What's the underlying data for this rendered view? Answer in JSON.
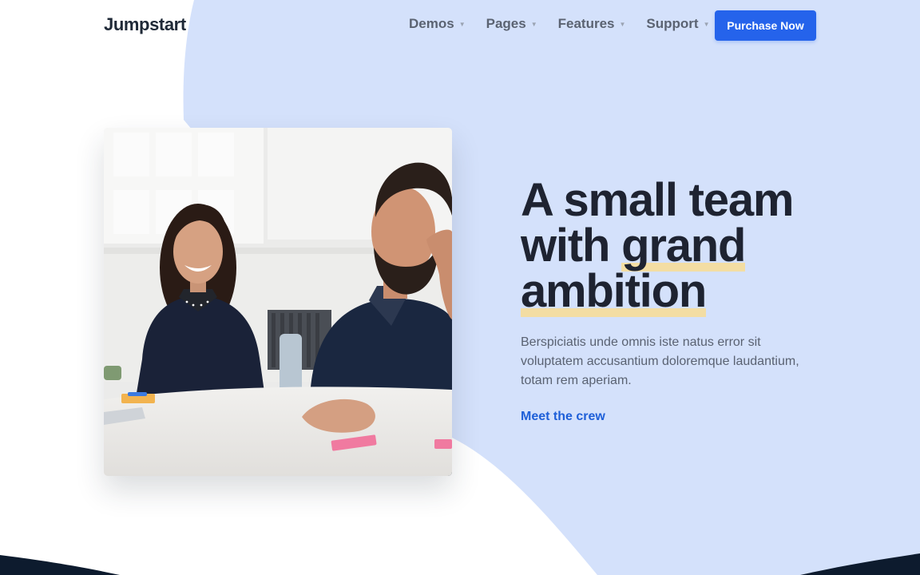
{
  "brand": {
    "name": "Jumpstart"
  },
  "nav": {
    "items": [
      {
        "label": "Demos"
      },
      {
        "label": "Pages"
      },
      {
        "label": "Features"
      },
      {
        "label": "Support"
      }
    ],
    "cta_label": "Purchase Now"
  },
  "hero": {
    "title_line1": "A small team",
    "title_line2_pre": "with ",
    "title_line2_highlight": "grand",
    "title_line3_highlight": "ambition",
    "lead": "Berspiciatis unde omnis iste natus error sit voluptatem accusantium doloremque laudantium, totam rem aperiam.",
    "link_label": "Meet the crew",
    "image_alt": "two-people-smiling-at-office-table-photo"
  },
  "colors": {
    "accent": "#2563eb",
    "link": "#1e5fd8",
    "blob": "#d4e1fb",
    "highlight": "#f3dda3",
    "footer_dark": "#0d1b2e",
    "heading": "#1e2331"
  }
}
